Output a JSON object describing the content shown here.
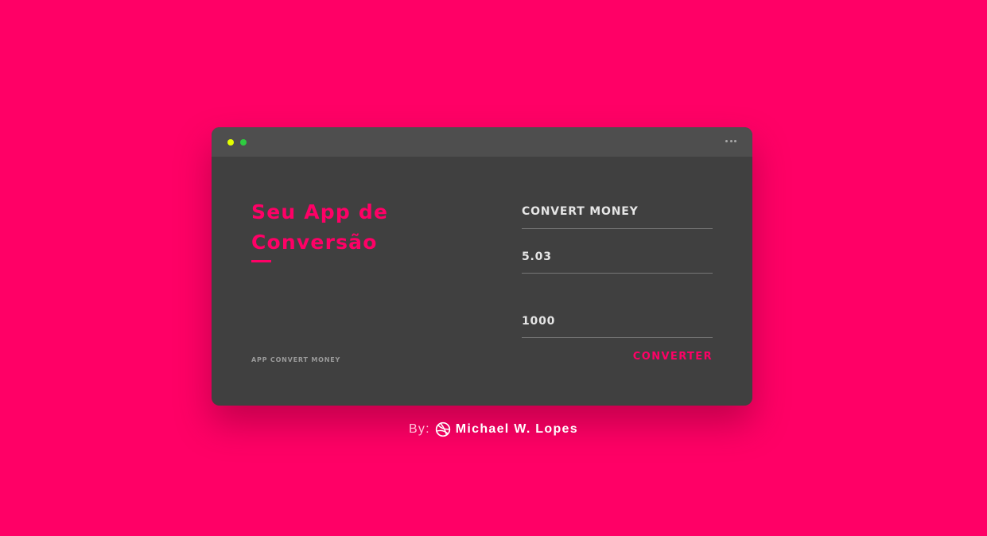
{
  "app": {
    "title": "Seu App de Conversão",
    "footer_label": "APP CONVERT MONEY"
  },
  "window_controls": {
    "dot_colors": [
      "#e4ff00",
      "#2ecc40"
    ],
    "menu_icon": "more-horizontal-icon"
  },
  "converter": {
    "section_title": "CONVERT MONEY",
    "rate_value": "5.03",
    "amount_value": "1000",
    "convert_label": "CONVERTER"
  },
  "credit": {
    "prefix": "By:",
    "icon": "dribbble-icon",
    "author": "Michael W. Lopes"
  },
  "colors": {
    "background": "#ff0066",
    "window": "#404040",
    "titlebar": "#4e4e4e",
    "accent": "#ff0066"
  }
}
